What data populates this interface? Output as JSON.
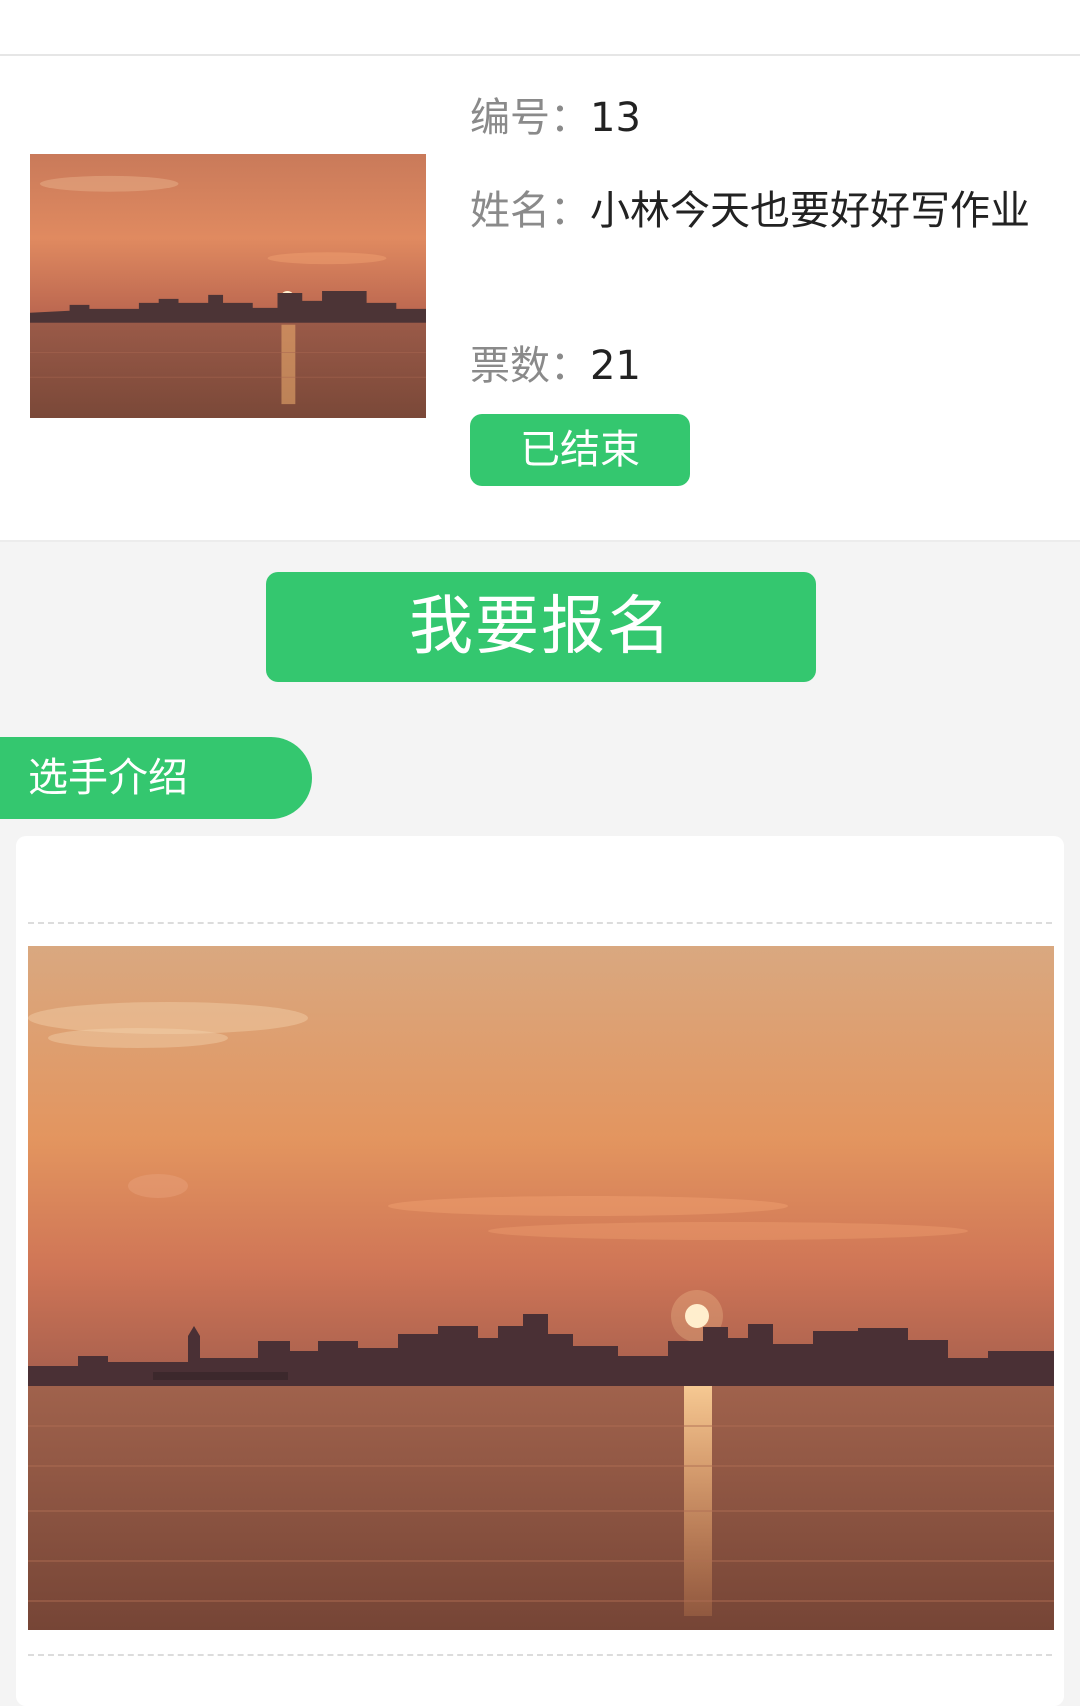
{
  "contestant": {
    "number_label": "编号：",
    "number_value": "13",
    "name_label": "姓名：",
    "name_value": "小林今天也要好好写作业",
    "votes_label": "票数：",
    "votes_value": "21",
    "status_label": "已结束"
  },
  "signup_button_label": "我要报名",
  "intro_tab_label": "选手介绍",
  "colors": {
    "accent": "#34c76f",
    "label_gray": "#8a8a8a"
  }
}
